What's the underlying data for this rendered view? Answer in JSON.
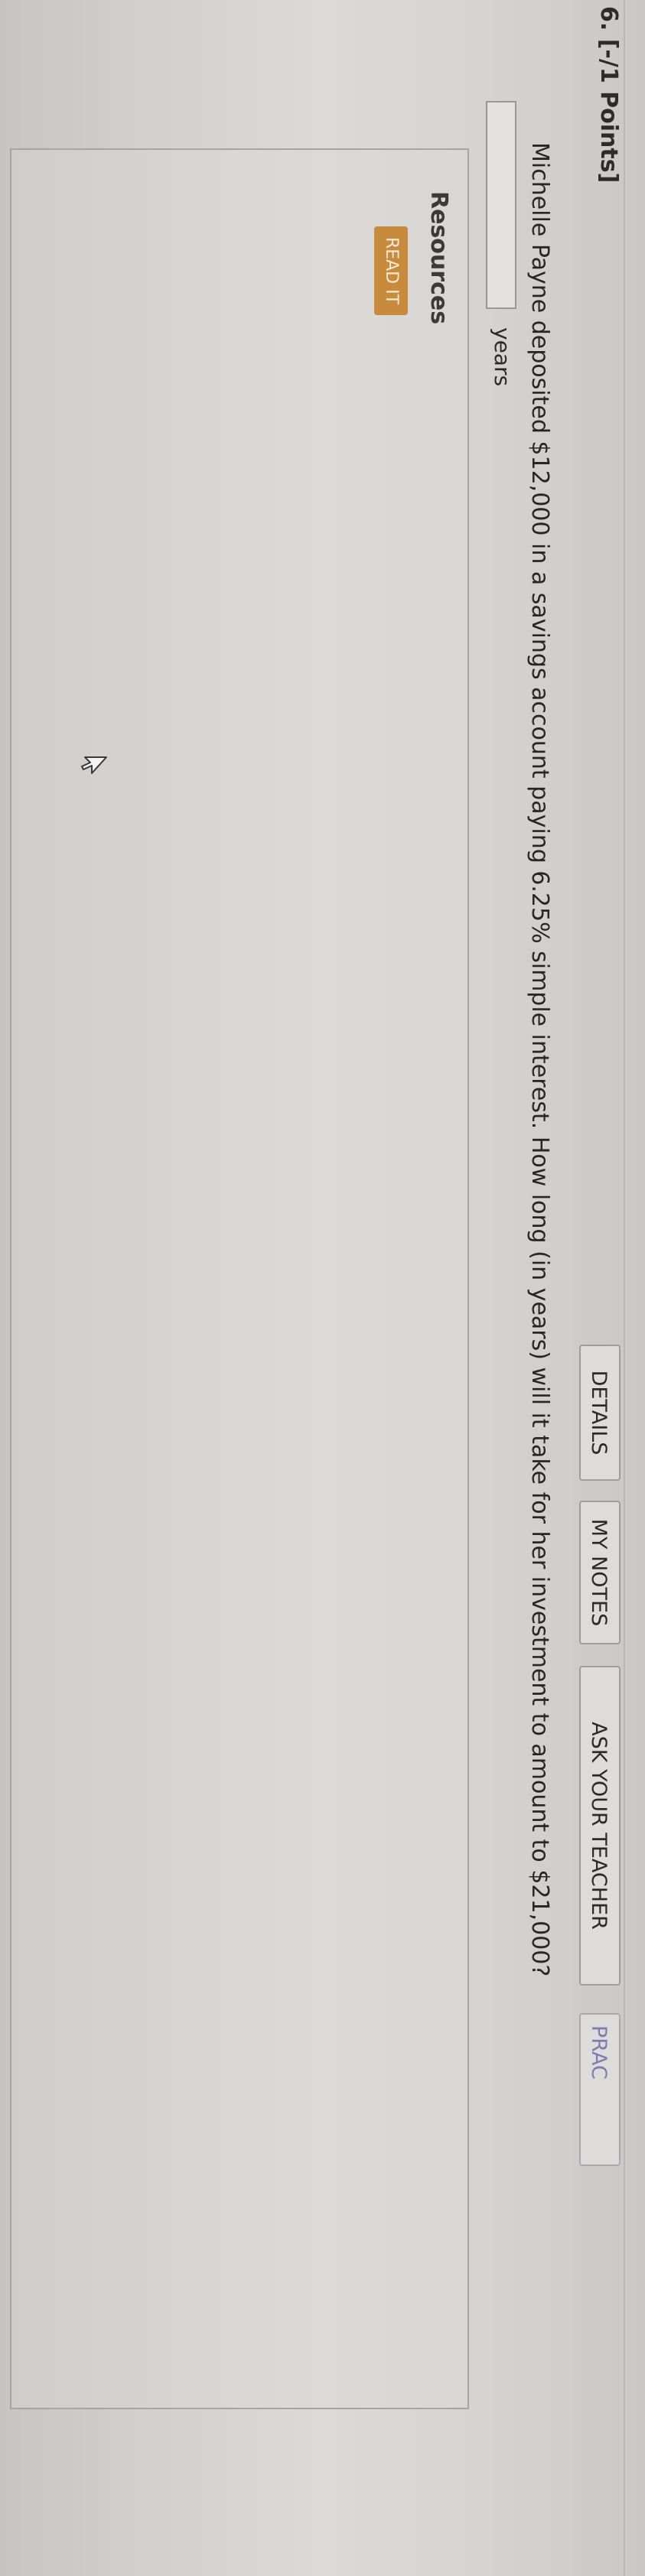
{
  "question": {
    "title": "6. [-/1 Points]",
    "text": "Michelle Payne deposited $12,000 in a savings account paying 6.25% simple interest. How long (in years) will it take for her investment to amount to $21,000?",
    "answer_value": "",
    "answer_units": "years"
  },
  "toolbar": {
    "details_label": "DETAILS",
    "my_notes_label": "MY NOTES",
    "ask_teacher_label": "ASK YOUR TEACHER",
    "practice_label": "PRAC"
  },
  "resources": {
    "title": "Resources",
    "read_it_label": "READ IT"
  },
  "icons": {
    "cursor": "mouse-pointer-icon"
  },
  "colors": {
    "read_it_button": "#c88a3c",
    "practice_text": "#7b7db0"
  }
}
